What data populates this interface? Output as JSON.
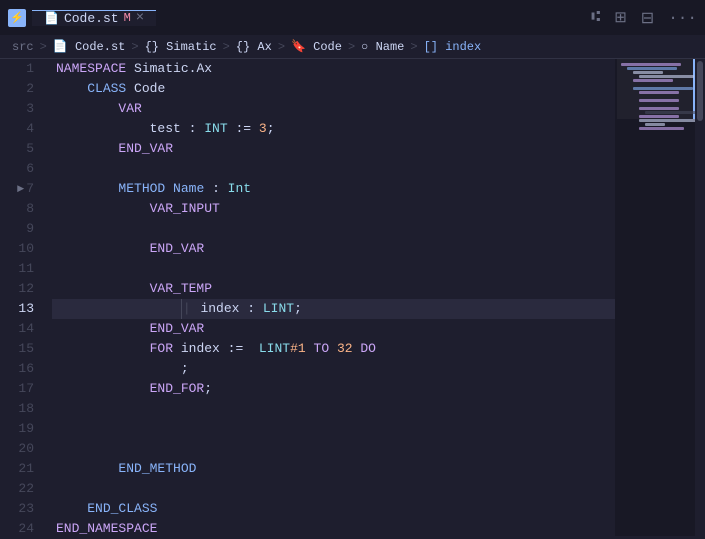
{
  "titlebar": {
    "app_name": "Code.st",
    "tab_label": "Code.st",
    "tab_modified": "M",
    "close_icon": "×",
    "title_icons": [
      "⣿",
      "⣿",
      "☰",
      "···"
    ]
  },
  "breadcrumb": {
    "items": [
      {
        "label": "src",
        "type": "folder",
        "icon": ""
      },
      {
        "label": "Code.st",
        "type": "file",
        "icon": "📄"
      },
      {
        "label": "Simatic",
        "type": "ns",
        "icon": "{}"
      },
      {
        "label": "Ax",
        "type": "ns",
        "icon": "{}"
      },
      {
        "label": "Code",
        "type": "class",
        "icon": "🔖"
      },
      {
        "label": "Name",
        "type": "method",
        "icon": "○"
      },
      {
        "label": "index",
        "type": "var",
        "icon": "[]"
      }
    ]
  },
  "lines": [
    {
      "num": 1,
      "content": "NAMESPACE Simatic.Ax",
      "active": false
    },
    {
      "num": 2,
      "content": "    CLASS Code",
      "active": false
    },
    {
      "num": 3,
      "content": "        VAR",
      "active": false
    },
    {
      "num": 4,
      "content": "            test : INT := 3;",
      "active": false
    },
    {
      "num": 5,
      "content": "        END_VAR",
      "active": false
    },
    {
      "num": 6,
      "content": "",
      "active": false
    },
    {
      "num": 7,
      "content": "        METHOD Name : Int",
      "active": false
    },
    {
      "num": 8,
      "content": "            VAR_INPUT",
      "active": false
    },
    {
      "num": 9,
      "content": "",
      "active": false
    },
    {
      "num": 10,
      "content": "            END_VAR",
      "active": false
    },
    {
      "num": 11,
      "content": "",
      "active": false
    },
    {
      "num": 12,
      "content": "            VAR_TEMP",
      "active": false
    },
    {
      "num": 13,
      "content": "                | index : LINT;",
      "active": true
    },
    {
      "num": 14,
      "content": "            END_VAR",
      "active": false
    },
    {
      "num": 15,
      "content": "            FOR index :=  LINT#1 TO 32 DO",
      "active": false
    },
    {
      "num": 16,
      "content": "                ;",
      "active": false
    },
    {
      "num": 17,
      "content": "            END_FOR;",
      "active": false
    },
    {
      "num": 18,
      "content": "",
      "active": false
    },
    {
      "num": 19,
      "content": "",
      "active": false
    },
    {
      "num": 20,
      "content": "",
      "active": false
    },
    {
      "num": 21,
      "content": "        END_METHOD",
      "active": false
    },
    {
      "num": 22,
      "content": "",
      "active": false
    },
    {
      "num": 23,
      "content": "    END_CLASS",
      "active": false
    },
    {
      "num": 24,
      "content": "END_NAMESPACE",
      "active": false
    }
  ],
  "colors": {
    "background": "#1e1e2e",
    "titlebar_bg": "#181825",
    "active_line": "#313244",
    "keyword_purple": "#cba6f7",
    "keyword_blue": "#89b4fa",
    "type_cyan": "#89dceb",
    "number_orange": "#fab387",
    "text_white": "#cdd6f4"
  }
}
